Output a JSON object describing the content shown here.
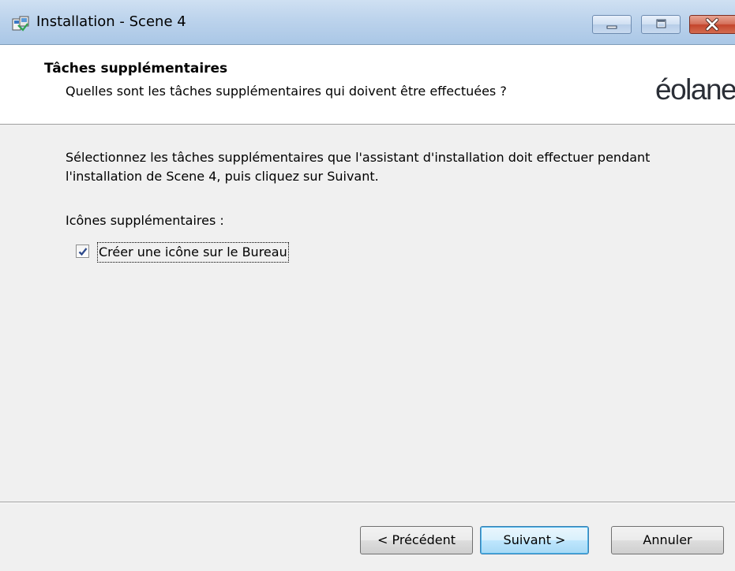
{
  "window": {
    "title": "Installation - Scene 4",
    "app_icon": "installer-icon",
    "controls": {
      "minimize_icon": "minimize-icon",
      "maximize_icon": "maximize-icon",
      "close_icon": "close-icon"
    }
  },
  "header": {
    "title": "Tâches supplémentaires",
    "subtitle": "Quelles sont les tâches supplémentaires qui doivent être effectuées ?",
    "logo_text": "éolane"
  },
  "body": {
    "instructions": "Sélectionnez les tâches supplémentaires que l'assistant d'installation doit effectuer pendant l'installation de Scene 4, puis cliquez sur Suivant.",
    "section_label": "Icônes supplémentaires :",
    "tasks": [
      {
        "label": "Créer une icône sur le Bureau",
        "checked": true
      }
    ]
  },
  "buttons": {
    "back": "< Précédent",
    "next": "Suivant >",
    "cancel": "Annuler"
  },
  "colors": {
    "accent": "#3c7fb1",
    "close_button": "#c4452c",
    "titlebar": "#bcd3ec"
  }
}
